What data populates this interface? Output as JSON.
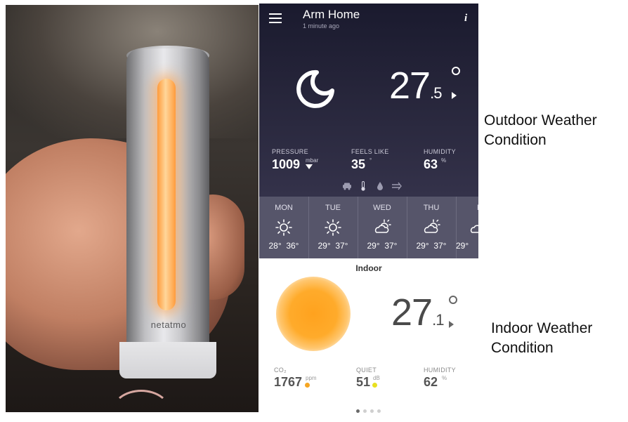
{
  "photo": {
    "brand": "netatmo"
  },
  "app": {
    "title": "Arm Home",
    "updated": "1 minute ago",
    "info_glyph": "i",
    "outdoor": {
      "icon": "moon-icon",
      "temp_int": "27",
      "temp_dec": ".5",
      "pressure_label": "PRESSURE",
      "pressure_value": "1009",
      "pressure_unit": "mbar",
      "feels_label": "FEELS LIKE",
      "feels_value": "35",
      "feels_unit": "°",
      "humidity_label": "HUMIDITY",
      "humidity_value": "63",
      "humidity_unit": "%",
      "small_icons": [
        "car-icon",
        "thermometer-icon",
        "drop-icon",
        "wind-icon"
      ]
    },
    "forecast": [
      {
        "day": "MON",
        "icon": "sun-icon",
        "low": "28°",
        "high": "36°"
      },
      {
        "day": "TUE",
        "icon": "sun-icon",
        "low": "29°",
        "high": "37°"
      },
      {
        "day": "WED",
        "icon": "partly-cloudy-icon",
        "low": "29°",
        "high": "37°"
      },
      {
        "day": "THU",
        "icon": "partly-cloudy-icon",
        "low": "29°",
        "high": "37°"
      },
      {
        "day": "F",
        "icon": "partly-cloudy-icon",
        "low": "29°",
        "high": ""
      }
    ],
    "indoor": {
      "title": "Indoor",
      "temp_int": "27",
      "temp_dec": ".1",
      "co2_label": "CO₂",
      "co2_value": "1767",
      "co2_unit": "ppm",
      "co2_color": "#f5a623",
      "quiet_label": "QUIET",
      "quiet_value": "51",
      "quiet_unit": "dB",
      "quiet_color": "#e8e020",
      "humidity_label": "HUMIDITY",
      "humidity_value": "62",
      "humidity_unit": "%"
    },
    "pager": {
      "count": 4,
      "active": 0
    }
  },
  "captions": {
    "outdoor": [
      "Outdoor Weather",
      "Condition"
    ],
    "indoor": [
      "Indoor Weather",
      "Condition"
    ]
  }
}
